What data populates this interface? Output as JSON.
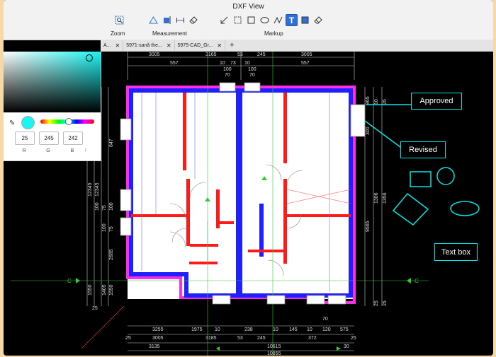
{
  "window": {
    "title": "DXF View"
  },
  "toolbar": {
    "zoom_label": "Zoom",
    "measurement_label": "Measurement",
    "markup_label": "Markup"
  },
  "tabs": [
    {
      "label": "A..."
    },
    {
      "label": "5971-sană the..."
    },
    {
      "label": "5975-CAD_Gr..."
    }
  ],
  "tab_add": "+",
  "tab_close": "✕",
  "color_picker": {
    "color": "#19f5f2",
    "r": "25",
    "g": "245",
    "b": "242",
    "r_label": "R",
    "g_label": "G",
    "b_label": "B"
  },
  "annotations": {
    "approved": "Approved",
    "revised": "Revised",
    "text_box": "Text box"
  },
  "drawing": {
    "top_dims": [
      "3005",
      "3165",
      "53",
      "245",
      "3005",
      "557",
      "557",
      "10",
      "73",
      "10",
      "100",
      "70",
      "100",
      "70"
    ],
    "bottom_dims": [
      "3255",
      "1975",
      "10",
      "238",
      "10",
      "145",
      "10",
      "120",
      "575",
      "3005",
      "3185",
      "53",
      "245",
      "372",
      "3135",
      "10615",
      "30",
      "10855",
      "25",
      "25",
      "70"
    ],
    "left_dims": [
      "12345",
      "12345",
      "100",
      "75",
      "100",
      "75",
      "100",
      "2685",
      "1550",
      "1405",
      "1550",
      "647",
      "25"
    ],
    "right_dims": [
      "965",
      "300",
      "1306",
      "1356",
      "9565",
      "25",
      "25",
      "10",
      "25"
    ],
    "axis_label": "C"
  }
}
